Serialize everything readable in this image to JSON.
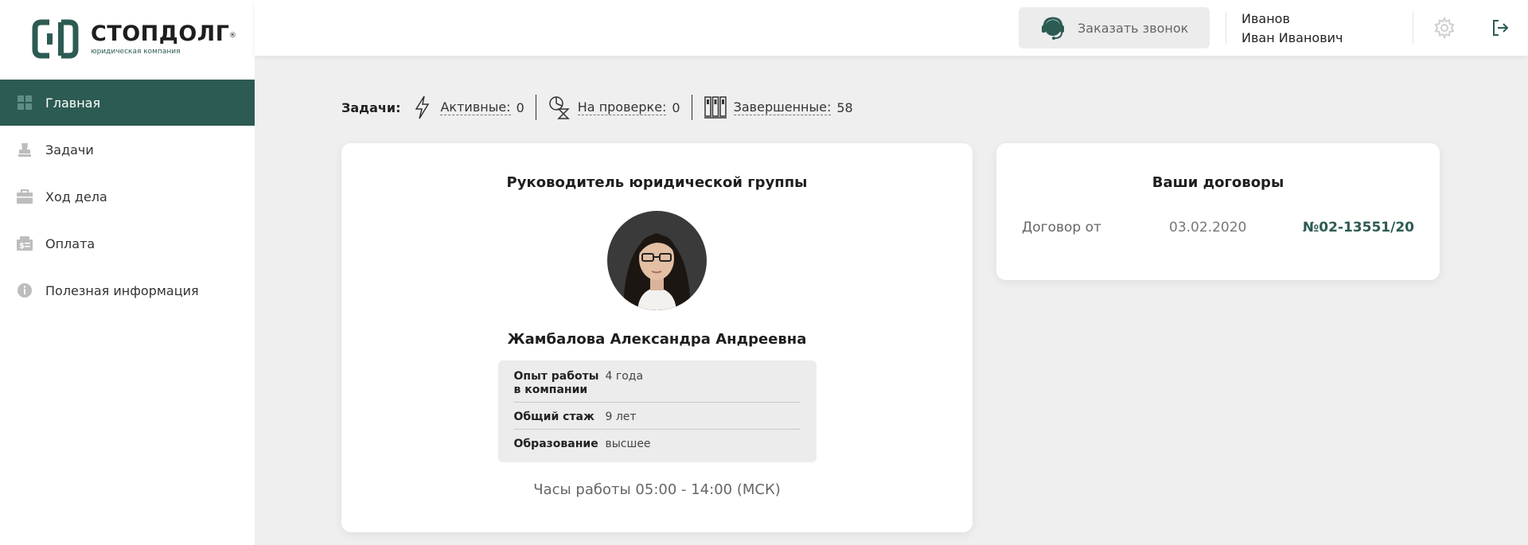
{
  "logo": {
    "name": "СТОПДОЛГ",
    "reg": "®",
    "subtitle": "юридическая компания"
  },
  "sidebar": {
    "items": [
      {
        "label": "Главная",
        "icon": "grid-icon",
        "active": true
      },
      {
        "label": "Задачи",
        "icon": "stamp-icon"
      },
      {
        "label": "Ход дела",
        "icon": "briefcase-icon"
      },
      {
        "label": "Оплата",
        "icon": "payment-icon"
      },
      {
        "label": "Полезная информация",
        "icon": "info-icon"
      }
    ]
  },
  "header": {
    "callback_label": "Заказать звонок",
    "user_last_name": "Иванов",
    "user_first_names": "Иван Иванович"
  },
  "tasks": {
    "title": "Задачи:",
    "active_label": "Активные:",
    "active_count": "0",
    "review_label": "На проверке:",
    "review_count": "0",
    "done_label": "Завершенные:",
    "done_count": "58"
  },
  "manager": {
    "title": "Руководитель юридической группы",
    "name": "Жамбалова Александра Андреевна",
    "info": [
      {
        "key": "Опыт работы в компании",
        "value": "4 года"
      },
      {
        "key": "Общий стаж",
        "value": "9 лет"
      },
      {
        "key": "Образование",
        "value": "высшее"
      }
    ],
    "hours": "Часы работы 05:00 - 14:00 (МСК)"
  },
  "contracts": {
    "title": "Ваши договоры",
    "label": "Договор от",
    "date": "03.02.2020",
    "number": "№02-13551/20"
  },
  "colors": {
    "accent": "#2c5b53",
    "background": "#efefef"
  }
}
